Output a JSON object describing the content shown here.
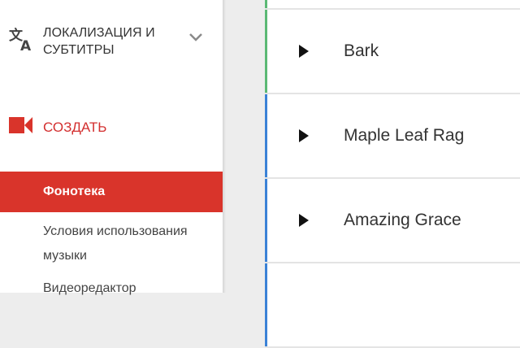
{
  "sidebar": {
    "localization": {
      "label": "ЛОКАЛИЗАЦИЯ И СУБТИТРЫ",
      "icon": "translate-icon",
      "toggle_icon": "chevron-down-icon"
    },
    "create": {
      "label": "СОЗДАТЬ",
      "icon": "video-camera-icon",
      "color": "#d32f2f"
    },
    "items": [
      {
        "label": "Фонотека",
        "active": true
      },
      {
        "label": "Условия использования музыки",
        "active": false
      },
      {
        "label": "Видеоредактор",
        "active": false
      }
    ],
    "active_bg": "#d9342b"
  },
  "tracks": [
    {
      "title": "",
      "accent": "#5bb974"
    },
    {
      "title": "Bark",
      "accent": "#5bb974"
    },
    {
      "title": "Maple Leaf Rag",
      "accent": "#3b82d6"
    },
    {
      "title": "Amazing Grace",
      "accent": "#3b82d6"
    },
    {
      "title": "",
      "accent": "#3b82d6"
    }
  ],
  "icons": {
    "track_play": "play-icon"
  }
}
